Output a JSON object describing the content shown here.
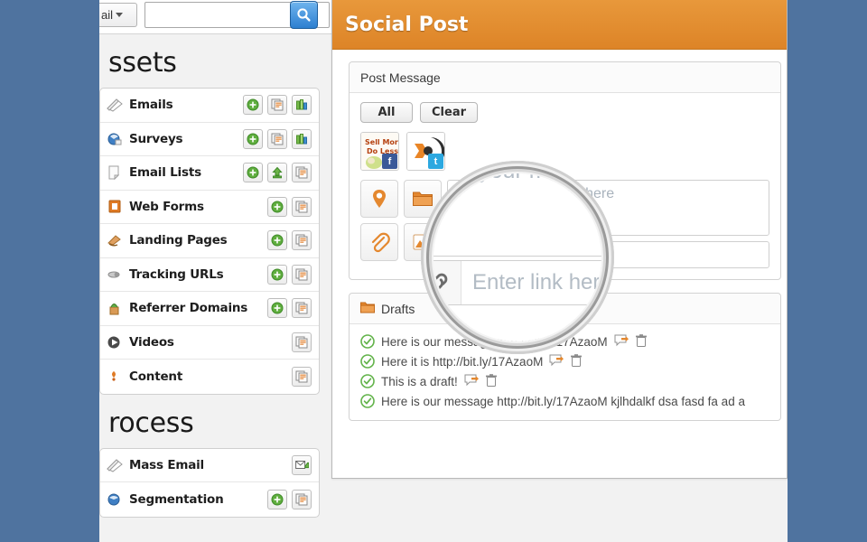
{
  "topbar": {
    "search_scope": "ail",
    "search_value": "",
    "search_placeholder": "",
    "search_button_icon": "search-icon"
  },
  "sidebar": {
    "sections": [
      {
        "title": "ssets",
        "items": [
          {
            "label": "Emails",
            "icon": "email-icon",
            "actions": [
              "add-icon",
              "copy-icon",
              "report-icon"
            ]
          },
          {
            "label": "Surveys",
            "icon": "survey-icon",
            "actions": [
              "add-icon",
              "copy-icon",
              "report-icon"
            ]
          },
          {
            "label": "Email Lists",
            "icon": "list-icon",
            "actions": [
              "add-icon",
              "upload-icon",
              "copy-icon"
            ]
          },
          {
            "label": "Web Forms",
            "icon": "form-icon",
            "actions": [
              "add-icon",
              "copy-icon"
            ]
          },
          {
            "label": "Landing Pages",
            "icon": "landing-page-icon",
            "actions": [
              "add-icon",
              "copy-icon"
            ]
          },
          {
            "label": "Tracking URLs",
            "icon": "link-icon",
            "actions": [
              "add-icon",
              "copy-icon"
            ]
          },
          {
            "label": "Referrer Domains",
            "icon": "domain-icon",
            "actions": [
              "add-icon",
              "copy-icon"
            ]
          },
          {
            "label": "Videos",
            "icon": "video-icon",
            "actions": [
              "copy-icon"
            ]
          },
          {
            "label": "Content",
            "icon": "content-icon",
            "actions": [
              "copy-icon"
            ]
          }
        ]
      },
      {
        "title": "rocess",
        "items": [
          {
            "label": "Mass Email",
            "icon": "mass-email-icon",
            "actions": [
              "send-email-icon"
            ]
          },
          {
            "label": "Segmentation",
            "icon": "segmentation-icon",
            "actions": [
              "add-icon",
              "copy-icon"
            ]
          }
        ]
      }
    ]
  },
  "main": {
    "title": "Social Post",
    "post_panel": {
      "header": "Post Message",
      "buttons": [
        "All",
        "Clear"
      ],
      "accounts": [
        {
          "name": "facebook-account",
          "network": "f",
          "caption": "Sell More, Do Less"
        },
        {
          "name": "twitter-account",
          "network": "t",
          "caption": ""
        }
      ],
      "tools": [
        {
          "name": "location-pin-icon"
        },
        {
          "name": "folder-icon"
        },
        {
          "name": "paperclip-icon"
        },
        {
          "name": "image-icon"
        }
      ],
      "message_value": "",
      "message_placeholder": "Type your message here",
      "link_icon": "link-chain-icon",
      "link_value": "",
      "link_placeholder": "Enter link here"
    },
    "drafts_panel": {
      "header": "Drafts",
      "header_icon": "folder-icon",
      "items": [
        {
          "text": "Here is our message http://bit.ly/17AzaoM",
          "status": "check-icon"
        },
        {
          "text": "Here it is http://bit.ly/17AzaoM",
          "status": "check-icon"
        },
        {
          "text": "This is a draft!",
          "status": "check-icon"
        },
        {
          "text": "Here is our message http://bit.ly/17AzaoM kjlhdalkf dsa fasd fa ad a",
          "status": "check-icon"
        }
      ],
      "row_actions": [
        "edit-icon",
        "delete-icon"
      ]
    }
  },
  "magnifier": {
    "zoomed_message_placeholder": "Type your messa",
    "zoomed_link_placeholder": "Enter link here",
    "zoomed_link_icon": "link-chain-icon"
  },
  "colors": {
    "desktop_background": "#4f739f",
    "header_orange": "#e0882c",
    "accent_blue": "#2d7fd0",
    "check_green": "#62b34a",
    "placeholder_gray": "#a9b3bd"
  }
}
